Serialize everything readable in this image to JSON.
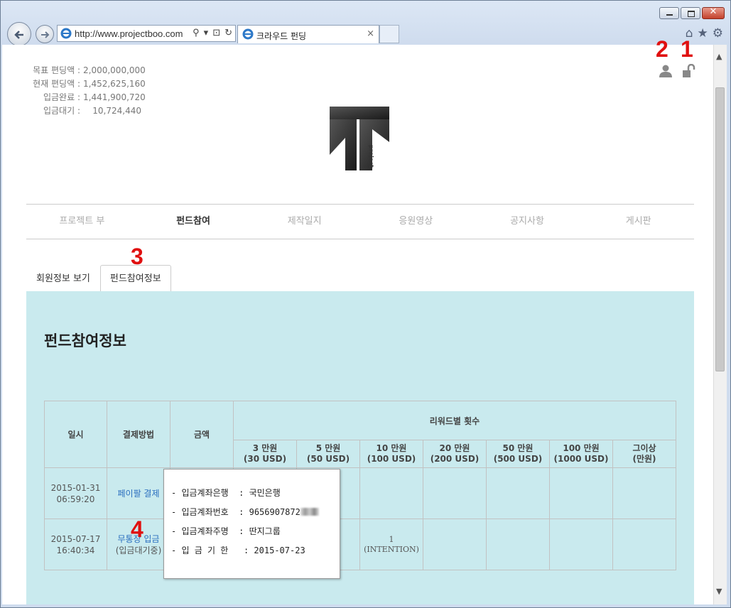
{
  "browser": {
    "url": "http://www.projectboo.com",
    "tab_title": "크라우드 펀딩",
    "tab_close": "×"
  },
  "stats": [
    {
      "label": "목표 편딩액 :",
      "value": "2,000,000,000"
    },
    {
      "label": "현재 편딩액 :",
      "value": "1,452,625,160"
    },
    {
      "label": "입금완료 :",
      "value": "1,441,900,720"
    },
    {
      "label": "입금대기 :",
      "value": "10,724,440"
    }
  ],
  "logo": {
    "text": "project"
  },
  "menu": [
    {
      "label": "프로젝트 부",
      "active": false
    },
    {
      "label": "펀드참여",
      "active": true
    },
    {
      "label": "제작일지",
      "active": false
    },
    {
      "label": "응원영상",
      "active": false
    },
    {
      "label": "공지사항",
      "active": false
    },
    {
      "label": "게시판",
      "active": false
    }
  ],
  "subtabs": [
    {
      "label": "회원정보 보기",
      "active": false
    },
    {
      "label": "펀드참여정보",
      "active": true
    }
  ],
  "panel": {
    "title": "펀드참여정보",
    "headers": {
      "date": "일시",
      "method": "결제방법",
      "amount": "금액",
      "rewards": "리워드별 횟수"
    },
    "reward_cols": [
      {
        "line1": "3 만원",
        "line2": "(30 USD)"
      },
      {
        "line1": "5 만원",
        "line2": "(50 USD)"
      },
      {
        "line1": "10 만원",
        "line2": "(100 USD)"
      },
      {
        "line1": "20 만원",
        "line2": "(200 USD)"
      },
      {
        "line1": "50 만원",
        "line2": "(500 USD)"
      },
      {
        "line1": "100 만원",
        "line2": "(1000 USD)"
      },
      {
        "line1": "그이상",
        "line2": "(만원)"
      }
    ],
    "rows": [
      {
        "date": "2015-01-31",
        "time": "06:59:20",
        "method": "페이팔 결제",
        "method_sub": ""
      },
      {
        "date": "2015-07-17",
        "time": "16:40:34",
        "method": "무통장 입금",
        "method_sub": "(입금대기중)",
        "r3_count": "1",
        "r3_note": "(INTENTION)"
      }
    ]
  },
  "popup": {
    "bank_label": "- 입금계좌은행  : ",
    "bank_value": "국민은행",
    "account_label": "- 입금계좌번호  : ",
    "account_value": "9656907872",
    "holder_label": "- 입금계좌주명  : ",
    "holder_value": "딴지그룹",
    "deadline_label": "- 입 금 기 한   : ",
    "deadline_value": "2015-07-23"
  },
  "annotations": {
    "a1": "1",
    "a2": "2",
    "a3": "3",
    "a4": "4",
    "color": "#e01010"
  }
}
